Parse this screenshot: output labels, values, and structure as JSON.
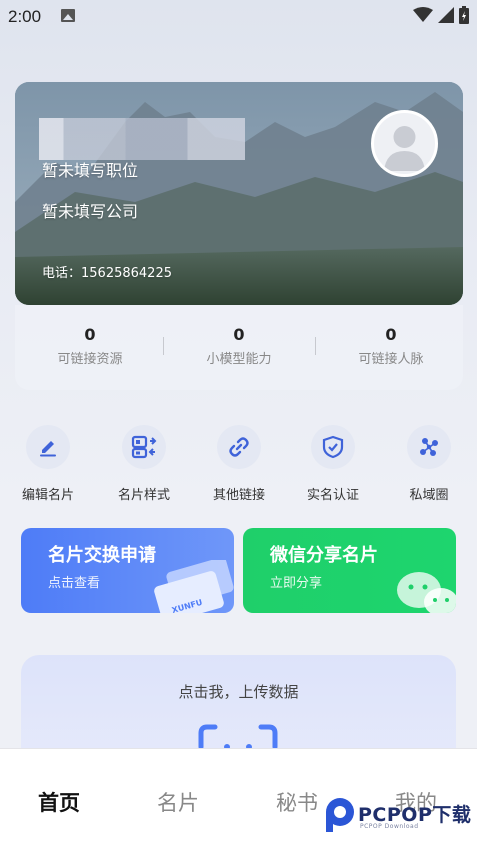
{
  "status_bar": {
    "time": "2:00"
  },
  "card": {
    "position": "暂未填写职位",
    "company": "暂未填写公司",
    "phone": "电话：15625864225"
  },
  "stats": [
    {
      "value": "0",
      "label": "可链接资源"
    },
    {
      "value": "0",
      "label": "小模型能力"
    },
    {
      "value": "0",
      "label": "可链接人脉"
    }
  ],
  "actions": [
    {
      "label": "编辑名片",
      "icon": "edit-icon"
    },
    {
      "label": "名片样式",
      "icon": "card-style-icon"
    },
    {
      "label": "其他链接",
      "icon": "link-icon"
    },
    {
      "label": "实名认证",
      "icon": "shield-check-icon"
    },
    {
      "label": "私域圈",
      "icon": "network-icon"
    }
  ],
  "tiles": {
    "exchange": {
      "title": "名片交换申请",
      "subtitle": "点击查看",
      "card_brand": "XUNFU"
    },
    "wechat": {
      "title": "微信分享名片",
      "subtitle": "立即分享"
    }
  },
  "upload": {
    "text": "点击我，上传数据"
  },
  "nav": [
    "首页",
    "名片",
    "秘书",
    "我的"
  ],
  "watermark": {
    "brand": "PCPOP下载",
    "sub": "PCPOP Download"
  },
  "colors": {
    "accent_blue": "#4e7cf7",
    "wechat_green": "#1fcf6a",
    "icon_blue": "#3f63d9"
  }
}
